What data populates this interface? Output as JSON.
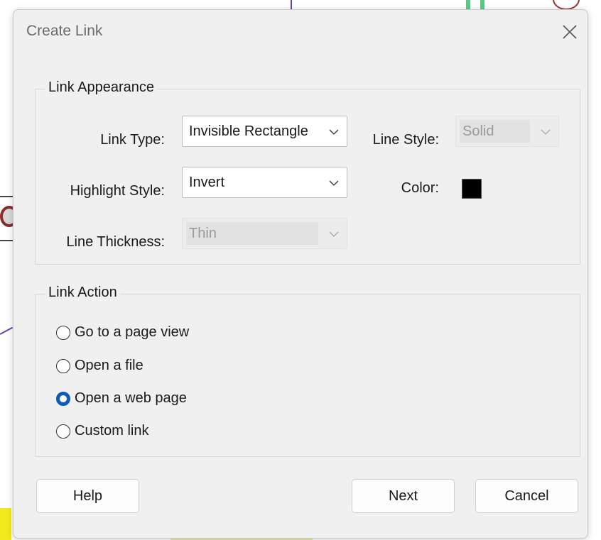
{
  "dialog": {
    "title": "Create Link",
    "close_icon": "close-icon"
  },
  "appearance": {
    "group_label": "Link Appearance",
    "link_type": {
      "label": "Link Type:",
      "value": "Invisible Rectangle"
    },
    "line_style": {
      "label": "Line Style:",
      "value": "Solid",
      "disabled": true
    },
    "highlight_style": {
      "label": "Highlight Style:",
      "value": "Invert"
    },
    "color": {
      "label": "Color:",
      "value": "#000000"
    },
    "line_thickness": {
      "label": "Line Thickness:",
      "value": "Thin",
      "disabled": true
    }
  },
  "action": {
    "group_label": "Link Action",
    "options": [
      {
        "label": "Go to a page view",
        "checked": false
      },
      {
        "label": "Open a file",
        "checked": false
      },
      {
        "label": "Open a web page",
        "checked": true
      },
      {
        "label": "Custom link",
        "checked": false
      }
    ]
  },
  "buttons": {
    "help": "Help",
    "next": "Next",
    "cancel": "Cancel"
  },
  "colors": {
    "accent": "#0f5ab5",
    "dialog_bg": "#f0f0f0"
  }
}
